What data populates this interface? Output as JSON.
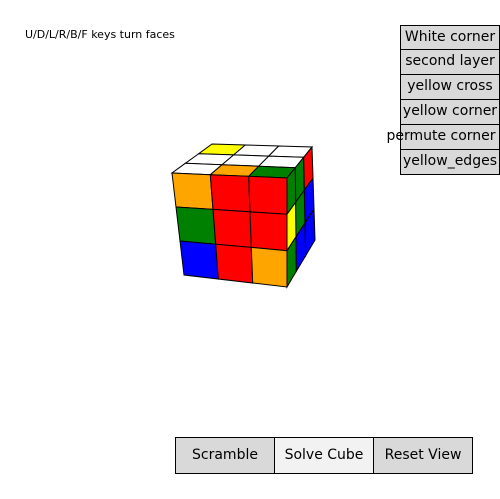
{
  "hint": "U/D/L/R/B/F keys turn faces",
  "solver_steps": [
    "White corner",
    "second layer",
    "yellow cross",
    "yellow corner",
    "permute corner",
    "yellow_edges"
  ],
  "controls": {
    "scramble": "Scramble",
    "solve": "Solve Cube",
    "reset": "Reset View"
  },
  "colors": {
    "W": "#ffffff",
    "Y": "#ffff00",
    "R": "#ff0000",
    "O": "#ffa500",
    "G": "#008000",
    "B": "#0000ff"
  },
  "cube": {
    "top": [
      [
        "Y",
        "W",
        "W"
      ],
      [
        "W",
        "W",
        "W"
      ],
      [
        "W",
        "O",
        "G"
      ]
    ],
    "front": [
      [
        "O",
        "R",
        "R"
      ],
      [
        "G",
        "R",
        "R"
      ],
      [
        "B",
        "R",
        "O"
      ]
    ],
    "right": [
      [
        "G",
        "G",
        "R"
      ],
      [
        "Y",
        "G",
        "B"
      ],
      [
        "G",
        "B",
        "B"
      ]
    ]
  }
}
